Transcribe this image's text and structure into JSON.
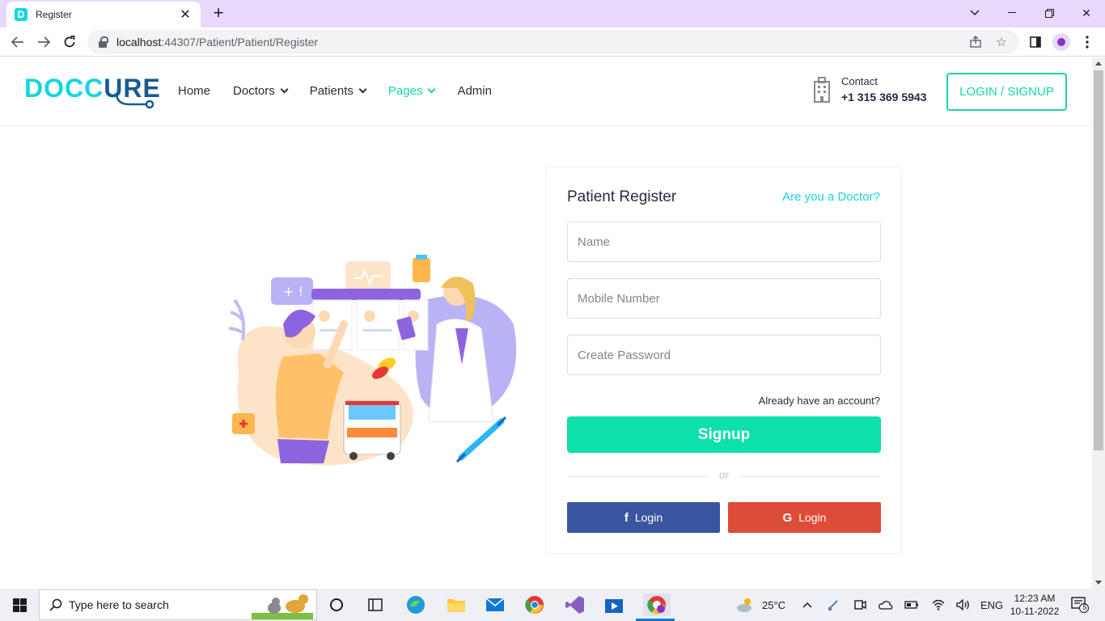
{
  "browser": {
    "tab_title": "Register",
    "tab_favicon_letter": "D",
    "url_host": "localhost",
    "url_rest": ":44307/Patient/Patient/Register"
  },
  "site": {
    "logo_part1": "DOCC",
    "logo_part2": "URE",
    "nav": [
      {
        "label": "Home",
        "dropdown": false,
        "active": false
      },
      {
        "label": "Doctors",
        "dropdown": true,
        "active": false
      },
      {
        "label": "Patients",
        "dropdown": true,
        "active": false
      },
      {
        "label": "Pages",
        "dropdown": true,
        "active": true
      },
      {
        "label": "Admin",
        "dropdown": false,
        "active": false
      }
    ],
    "contact_label": "Contact",
    "contact_phone": "+1 315 369 5943",
    "login_signup": "LOGIN / SIGNUP"
  },
  "register": {
    "title": "Patient Register",
    "doctor_link": "Are you a Doctor?",
    "name_placeholder": "Name",
    "mobile_placeholder": "Mobile Number",
    "password_placeholder": "Create Password",
    "have_account": "Already have an account?",
    "signup": "Signup",
    "or": "or",
    "facebook_login": "Login",
    "google_login": "Login"
  },
  "taskbar": {
    "search_placeholder": "Type here to search",
    "weather": "25°C",
    "language": "ENG",
    "time": "12:23 AM",
    "date": "10-11-2022",
    "notification_count": "5"
  },
  "colors": {
    "accent_teal": "#15d5a8",
    "accent_cyan": "#15d5e0",
    "signup_green": "#0de0aa",
    "facebook_blue": "#3a559f",
    "google_red": "#dd4b39",
    "chrome_tab_bar": "#e8d8fb"
  }
}
